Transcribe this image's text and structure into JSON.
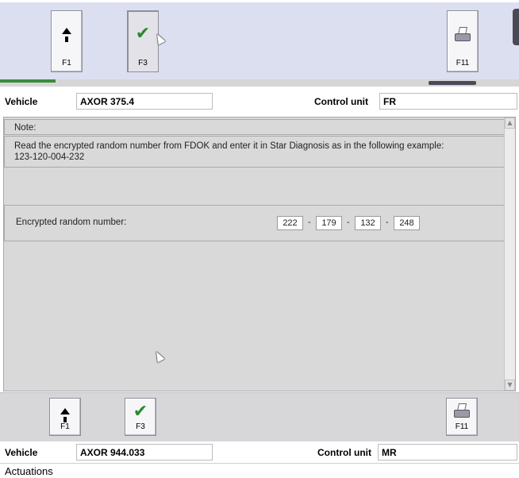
{
  "top_toolbar": {
    "buttons": [
      {
        "key": "F1",
        "icon": "arrow-up-icon"
      },
      {
        "key": "F3",
        "icon": "checkmark-icon"
      },
      {
        "key": "F11",
        "icon": "printer-icon"
      }
    ],
    "check_glyph": "✔"
  },
  "top_vehicle": {
    "vehicle_label": "Vehicle",
    "vehicle_value": "AXOR 375.4",
    "control_unit_label": "Control unit",
    "control_unit_value": "FR"
  },
  "dialog": {
    "note_heading": "Note:",
    "note_text_line1": "Read the encrypted random number from FDOK and enter it in Star Diagnosis as in the following example:",
    "note_text_line2": "123-120-004-232",
    "encrypted_label": "Encrypted random number:",
    "encrypted_values": [
      "222",
      "179",
      "132",
      "248"
    ],
    "separator": "-"
  },
  "bottom_toolbar": {
    "buttons": [
      {
        "key": "F1",
        "icon": "arrow-up-icon"
      },
      {
        "key": "F3",
        "icon": "checkmark-icon"
      },
      {
        "key": "F11",
        "icon": "printer-icon"
      }
    ],
    "check_glyph": "✔"
  },
  "bottom_vehicle": {
    "vehicle_label": "Vehicle",
    "vehicle_value": "AXOR 944.033",
    "control_unit_label": "Control unit",
    "control_unit_value": "MR"
  },
  "footer": {
    "section_label": "Actuations"
  },
  "colors": {
    "toolbar_top_bg": "#dcdff0",
    "panel_bg": "#d9d9d9",
    "check_green": "#2a8a2a"
  }
}
